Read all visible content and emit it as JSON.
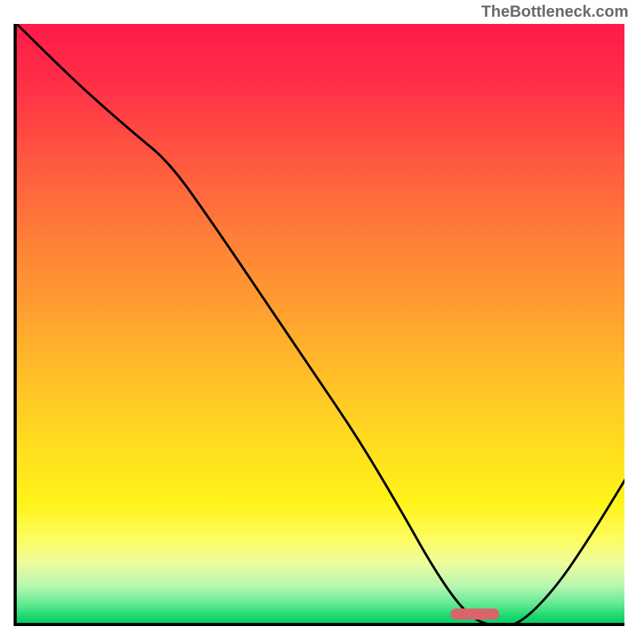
{
  "watermark": "TheBottleneck.com",
  "chart_data": {
    "type": "line",
    "title": "",
    "xlabel": "",
    "ylabel": "",
    "xlim": [
      0,
      100
    ],
    "ylim": [
      0,
      100
    ],
    "series": [
      {
        "name": "bottleneck-curve",
        "x": [
          0,
          10,
          19,
          25,
          32,
          40,
          48,
          56,
          63,
          68,
          72,
          75,
          78,
          82,
          88,
          94,
          100
        ],
        "values": [
          100,
          90,
          82,
          77,
          67,
          55,
          43,
          31,
          19,
          10,
          4,
          1,
          0,
          0,
          6,
          15,
          25
        ]
      }
    ],
    "marker": {
      "x_center": 75,
      "y": 1,
      "width_pct": 8
    },
    "gradient_stops": [
      {
        "pct": 0,
        "color": "#ff1a4a"
      },
      {
        "pct": 50,
        "color": "#ffb02c"
      },
      {
        "pct": 85,
        "color": "#fff85a"
      },
      {
        "pct": 100,
        "color": "#0acf63"
      }
    ]
  }
}
